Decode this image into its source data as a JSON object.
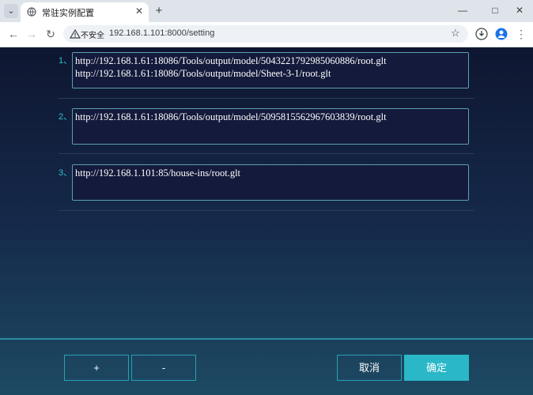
{
  "browser": {
    "tab_title": "常驻实例配置",
    "tab_menu_icon": "chevron-down-icon",
    "new_tab_label": "+",
    "security_label": "不安全",
    "url": "192.168.1.101:8000/setting"
  },
  "entries": [
    {
      "number": "1、",
      "value": "http://192.168.1.61:18086/Tools/output/model/5043221792985060886/root.glt\nhttp://192.168.1.61:18086/Tools/output/model/Sheet-3-1/root.glt"
    },
    {
      "number": "2、",
      "value": "http://192.168.1.61:18086/Tools/output/model/5095815562967603839/root.glt"
    },
    {
      "number": "3、",
      "value": "http://192.168.1.101:85/house-ins/root.glt"
    }
  ],
  "footer": {
    "add_label": "+",
    "remove_label": "-",
    "cancel_label": "取消",
    "confirm_label": "确定"
  },
  "colors": {
    "accent": "#2ab7c8",
    "page_bg_top": "#0e1630",
    "page_bg_bottom": "#1d4a63",
    "textarea_bg": "#131a3b"
  }
}
